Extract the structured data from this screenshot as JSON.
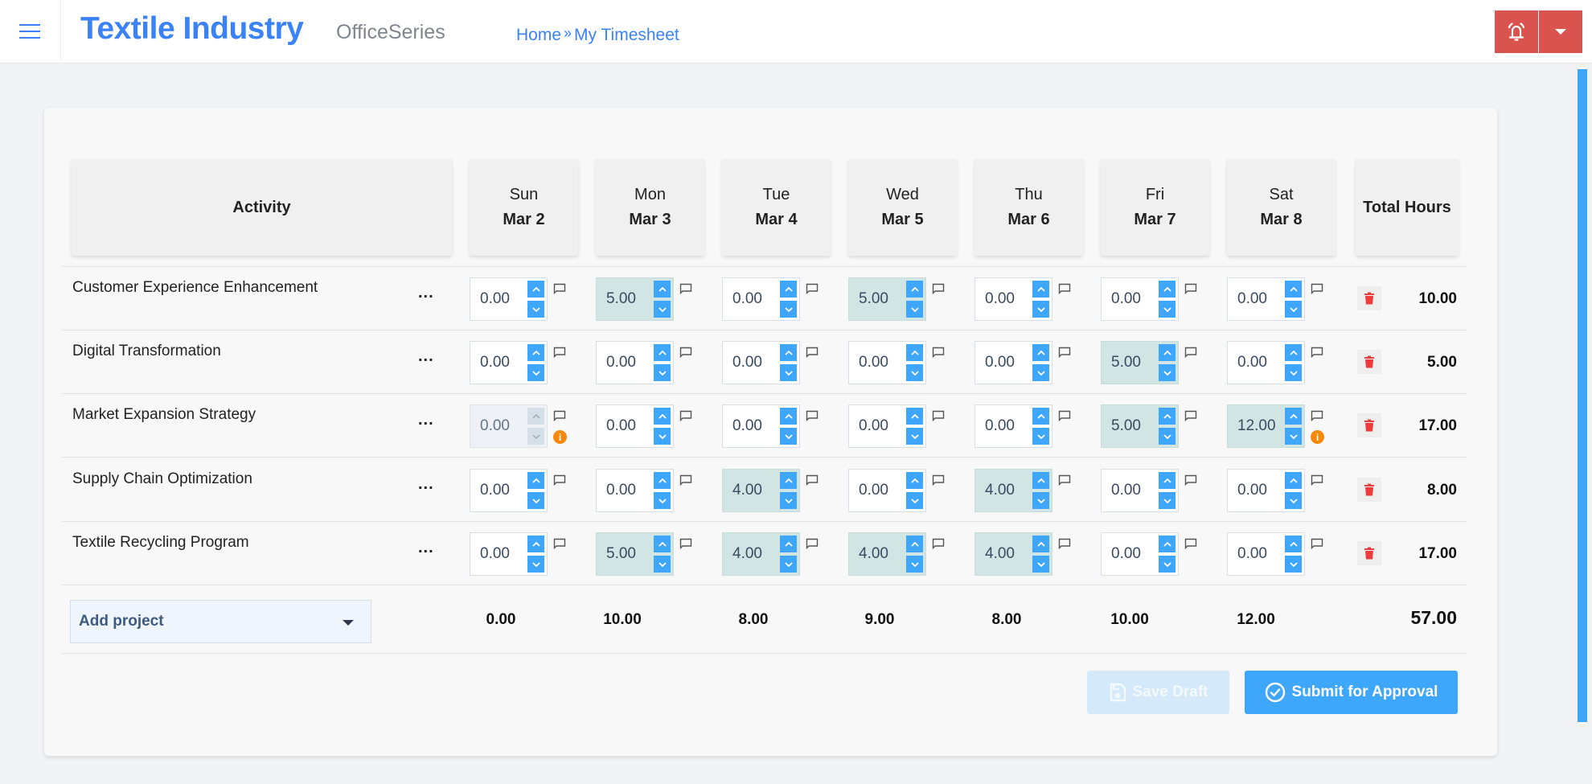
{
  "header": {
    "brand": "Textile Industry",
    "subbrand": "OfficeSeries",
    "breadcrumb": [
      {
        "label": "Home"
      },
      {
        "label": "My Timesheet"
      }
    ],
    "breadcrumb_separator": "»",
    "alert_icon": "bell-icon",
    "dropdown_icon": "caret-down-icon"
  },
  "table": {
    "activity_header": "Activity",
    "total_header": "Total Hours",
    "days": [
      {
        "day": "Sun",
        "date": "Mar 2"
      },
      {
        "day": "Mon",
        "date": "Mar 3"
      },
      {
        "day": "Tue",
        "date": "Mar 4"
      },
      {
        "day": "Wed",
        "date": "Mar 5"
      },
      {
        "day": "Thu",
        "date": "Mar 6"
      },
      {
        "day": "Fri",
        "date": "Mar 7"
      },
      {
        "day": "Sat",
        "date": "Mar 8"
      }
    ],
    "rows": [
      {
        "activity": "Customer Experience Enhancement",
        "menu_label": "...",
        "hours": [
          "0.00",
          "5.00",
          "0.00",
          "5.00",
          "0.00",
          "0.00",
          "0.00"
        ],
        "filled": [
          false,
          true,
          false,
          true,
          false,
          false,
          false
        ],
        "disabled": [
          false,
          false,
          false,
          false,
          false,
          false,
          false
        ],
        "info": [
          false,
          false,
          false,
          false,
          false,
          false,
          false
        ],
        "total": "10.00"
      },
      {
        "activity": "Digital Transformation",
        "menu_label": "...",
        "hours": [
          "0.00",
          "0.00",
          "0.00",
          "0.00",
          "0.00",
          "5.00",
          "0.00"
        ],
        "filled": [
          false,
          false,
          false,
          false,
          false,
          true,
          false
        ],
        "disabled": [
          false,
          false,
          false,
          false,
          false,
          false,
          false
        ],
        "info": [
          false,
          false,
          false,
          false,
          false,
          false,
          false
        ],
        "total": "5.00"
      },
      {
        "activity": "Market Expansion Strategy",
        "menu_label": "...",
        "hours": [
          "0.00",
          "0.00",
          "0.00",
          "0.00",
          "0.00",
          "5.00",
          "12.00"
        ],
        "filled": [
          false,
          false,
          false,
          false,
          false,
          true,
          true
        ],
        "disabled": [
          true,
          false,
          false,
          false,
          false,
          false,
          false
        ],
        "info": [
          true,
          false,
          false,
          false,
          false,
          false,
          true
        ],
        "total": "17.00"
      },
      {
        "activity": "Supply Chain Optimization",
        "menu_label": "...",
        "hours": [
          "0.00",
          "0.00",
          "4.00",
          "0.00",
          "4.00",
          "0.00",
          "0.00"
        ],
        "filled": [
          false,
          false,
          true,
          false,
          true,
          false,
          false
        ],
        "disabled": [
          false,
          false,
          false,
          false,
          false,
          false,
          false
        ],
        "info": [
          false,
          false,
          false,
          false,
          false,
          false,
          false
        ],
        "total": "8.00"
      },
      {
        "activity": "Textile Recycling Program",
        "menu_label": "...",
        "hours": [
          "0.00",
          "5.00",
          "4.00",
          "4.00",
          "4.00",
          "0.00",
          "0.00"
        ],
        "filled": [
          false,
          true,
          true,
          true,
          true,
          false,
          false
        ],
        "disabled": [
          false,
          false,
          false,
          false,
          false,
          false,
          false
        ],
        "info": [
          false,
          false,
          false,
          false,
          false,
          false,
          false
        ],
        "total": "17.00"
      }
    ],
    "day_totals": [
      "0.00",
      "10.00",
      "8.00",
      "9.00",
      "8.00",
      "10.00",
      "12.00"
    ],
    "grand_total": "57.00",
    "info_glyph": "i"
  },
  "add_project": {
    "label": "Add project"
  },
  "actions": {
    "save_draft": "Save Draft",
    "submit": "Submit for Approval"
  },
  "colors": {
    "accent": "#3b82f6",
    "spinner": "#3ea6fb",
    "alert": "#d9534f",
    "filled_cell": "#d1e5e5",
    "info": "#f7890a",
    "trash": "#ef3b3b"
  }
}
